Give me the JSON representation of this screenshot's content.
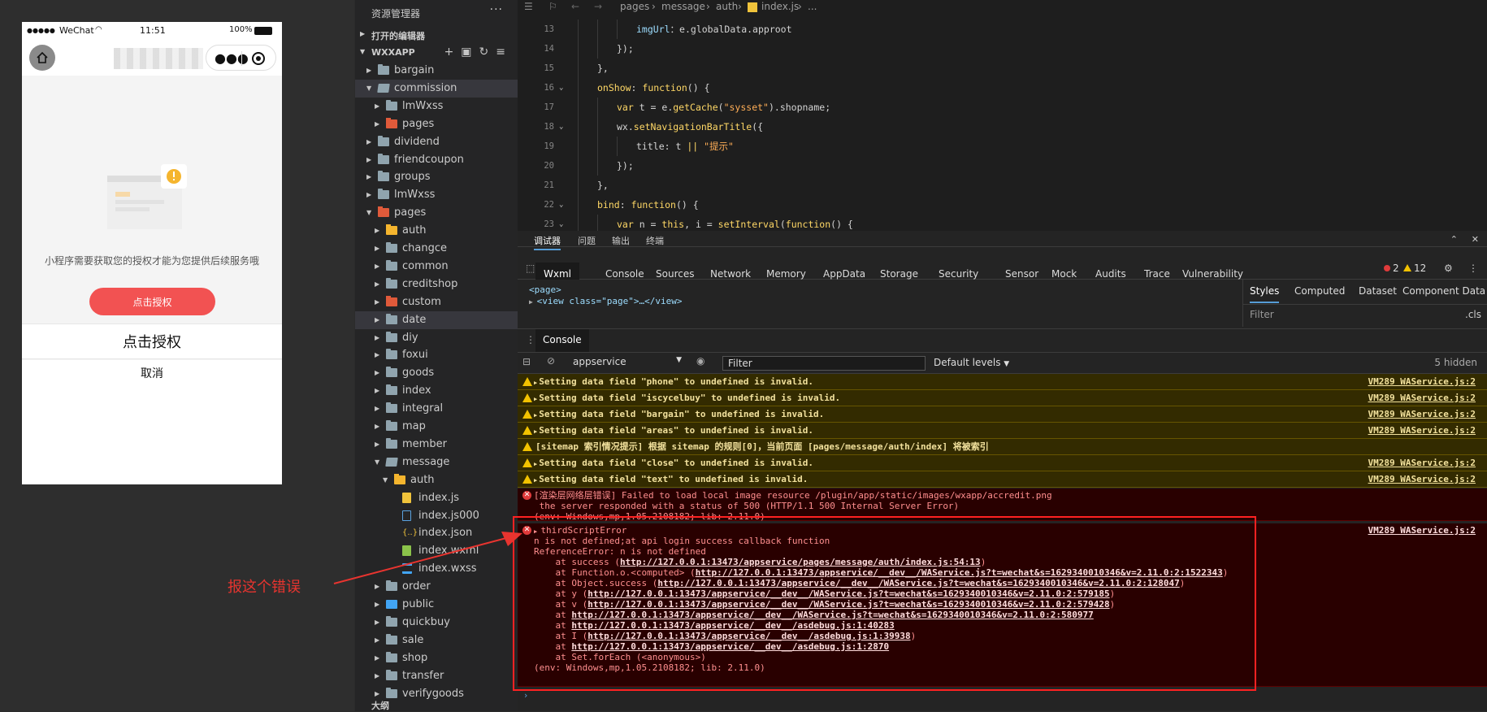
{
  "simulator": {
    "status": {
      "dots": "●●●●●",
      "carrier": "WeChat",
      "time": "11:51",
      "battery": "100%"
    },
    "auth_message": "小程序需要获取您的授权才能为您提供后续服务哦",
    "auth_button": "点击授权",
    "sheet_primary": "点击授权",
    "sheet_cancel": "取消"
  },
  "annotation": "报这个错误",
  "explorer": {
    "title": "资源管理器",
    "more": "···",
    "open_editors": "打开的编辑器",
    "project": "WXXAPP",
    "bottom_section": "大纲",
    "tree": [
      {
        "name": "bargain",
        "depth": 1,
        "icon": "folder",
        "expanded": false
      },
      {
        "name": "commission",
        "depth": 1,
        "icon": "folder-open",
        "expanded": true,
        "selected": true
      },
      {
        "name": "lmWxss",
        "depth": 2,
        "icon": "folder",
        "expanded": false
      },
      {
        "name": "pages",
        "depth": 2,
        "icon": "red",
        "expanded": false
      },
      {
        "name": "dividend",
        "depth": 1,
        "icon": "folder",
        "expanded": false
      },
      {
        "name": "friendcoupon",
        "depth": 1,
        "icon": "folder",
        "expanded": false
      },
      {
        "name": "groups",
        "depth": 1,
        "icon": "folder",
        "expanded": false
      },
      {
        "name": "lmWxss",
        "depth": 1,
        "icon": "folder",
        "expanded": false
      },
      {
        "name": "pages",
        "depth": 1,
        "icon": "red",
        "expanded": true
      },
      {
        "name": "auth",
        "depth": 2,
        "icon": "yellow",
        "expanded": false
      },
      {
        "name": "changce",
        "depth": 2,
        "icon": "folder",
        "expanded": false
      },
      {
        "name": "common",
        "depth": 2,
        "icon": "folder",
        "expanded": false
      },
      {
        "name": "creditshop",
        "depth": 2,
        "icon": "folder",
        "expanded": false
      },
      {
        "name": "custom",
        "depth": 2,
        "icon": "red",
        "expanded": false
      },
      {
        "name": "date",
        "depth": 2,
        "icon": "folder",
        "expanded": false,
        "selected": true
      },
      {
        "name": "diy",
        "depth": 2,
        "icon": "folder",
        "expanded": false
      },
      {
        "name": "foxui",
        "depth": 2,
        "icon": "folder",
        "expanded": false
      },
      {
        "name": "goods",
        "depth": 2,
        "icon": "folder",
        "expanded": false
      },
      {
        "name": "index",
        "depth": 2,
        "icon": "folder",
        "expanded": false
      },
      {
        "name": "integral",
        "depth": 2,
        "icon": "folder",
        "expanded": false
      },
      {
        "name": "map",
        "depth": 2,
        "icon": "folder",
        "expanded": false
      },
      {
        "name": "member",
        "depth": 2,
        "icon": "folder",
        "expanded": false
      },
      {
        "name": "message",
        "depth": 2,
        "icon": "folder-open",
        "expanded": true
      },
      {
        "name": "auth",
        "depth": 3,
        "icon": "yellow",
        "expanded": true
      },
      {
        "name": "index.js",
        "depth": 4,
        "icon": "file-js",
        "file": true
      },
      {
        "name": "index.js000",
        "depth": 4,
        "icon": "file-txt",
        "file": true
      },
      {
        "name": "index.json",
        "depth": 4,
        "icon": "file-json",
        "file": true
      },
      {
        "name": "index.wxml",
        "depth": 4,
        "icon": "file-wxml",
        "file": true
      },
      {
        "name": "index.wxss",
        "depth": 4,
        "icon": "file-wxss",
        "file": true
      },
      {
        "name": "order",
        "depth": 2,
        "icon": "folder",
        "expanded": false
      },
      {
        "name": "public",
        "depth": 2,
        "icon": "blue",
        "expanded": false
      },
      {
        "name": "quickbuy",
        "depth": 2,
        "icon": "folder",
        "expanded": false
      },
      {
        "name": "sale",
        "depth": 2,
        "icon": "folder",
        "expanded": false
      },
      {
        "name": "shop",
        "depth": 2,
        "icon": "folder",
        "expanded": false
      },
      {
        "name": "transfer",
        "depth": 2,
        "icon": "folder",
        "expanded": false
      },
      {
        "name": "verifygoods",
        "depth": 2,
        "icon": "folder",
        "expanded": false
      }
    ]
  },
  "editor": {
    "breadcrumb": [
      "pages",
      "message",
      "auth",
      "index.js",
      "..."
    ],
    "lines": [
      {
        "n": "13",
        "indent": 3,
        "code": [
          [
            "k-m",
            "imgUrl"
          ],
          [
            "",
            "：e.globalData.approot"
          ]
        ]
      },
      {
        "n": "14",
        "indent": 2,
        "code": [
          [
            "",
            "});"
          ]
        ]
      },
      {
        "n": "15",
        "indent": 1,
        "code": [
          [
            "",
            "},"
          ]
        ]
      },
      {
        "n": "16",
        "indent": 1,
        "fold": true,
        "code": [
          [
            "k-prop",
            "onShow"
          ],
          [
            "",
            ": "
          ],
          [
            "k-kw",
            "function"
          ],
          [
            "",
            "() {"
          ]
        ]
      },
      {
        "n": "17",
        "indent": 2,
        "code": [
          [
            "k-kw",
            "var"
          ],
          [
            "",
            " t = e."
          ],
          [
            "k-fn",
            "getCache"
          ],
          [
            "",
            "("
          ],
          [
            "k-str",
            "\"sysset\""
          ],
          [
            "",
            ").shopname;"
          ]
        ]
      },
      {
        "n": "18",
        "indent": 2,
        "fold": true,
        "code": [
          [
            "",
            "wx."
          ],
          [
            "k-fn",
            "setNavigationBarTitle"
          ],
          [
            "",
            "({"
          ]
        ]
      },
      {
        "n": "19",
        "indent": 3,
        "code": [
          [
            "",
            "title: t "
          ],
          [
            "k-kw",
            "||"
          ],
          [
            "",
            " "
          ],
          [
            "k-str",
            "\"提示\""
          ]
        ]
      },
      {
        "n": "20",
        "indent": 2,
        "code": [
          [
            "",
            "});"
          ]
        ]
      },
      {
        "n": "21",
        "indent": 1,
        "code": [
          [
            "",
            "},"
          ]
        ]
      },
      {
        "n": "22",
        "indent": 1,
        "fold": true,
        "code": [
          [
            "k-prop",
            "bind"
          ],
          [
            "",
            ": "
          ],
          [
            "k-kw",
            "function"
          ],
          [
            "",
            "() {"
          ]
        ]
      },
      {
        "n": "23",
        "indent": 2,
        "fold": true,
        "code": [
          [
            "k-kw",
            "var"
          ],
          [
            "",
            " n = "
          ],
          [
            "k-kw",
            "this"
          ],
          [
            "",
            ", i = "
          ],
          [
            "k-fn",
            "setInterval"
          ],
          [
            "",
            "("
          ],
          [
            "k-kw",
            "function"
          ],
          [
            "",
            "() {"
          ]
        ]
      }
    ]
  },
  "devtools": {
    "top_tabs": [
      "调试器",
      "问题",
      "输出",
      "终端"
    ],
    "panels": [
      "Wxml",
      "Console",
      "Sources",
      "Network",
      "Memory",
      "AppData",
      "Storage",
      "Security",
      "Sensor",
      "Mock",
      "Audits",
      "Trace",
      "Vulnerability"
    ],
    "counts": {
      "errors": "2",
      "warnings": "12"
    },
    "dom": [
      "<page>",
      "<view class=\"page\">…</view>"
    ],
    "style_tabs": [
      "Styles",
      "Computed",
      "Dataset",
      "Component Data"
    ],
    "styles_filter": "Filter",
    "styles_cls": ".cls",
    "console_tab": "Console",
    "context": "appservice",
    "filter_placeholder": "Filter",
    "levels": "Default levels",
    "hidden": "5 hidden"
  },
  "console": {
    "warnings": [
      {
        "text": "Setting data field \"phone\" to undefined is invalid.",
        "src": "VM289 WAService.js:2"
      },
      {
        "text": "Setting data field \"iscycelbuy\" to undefined is invalid.",
        "src": "VM289 WAService.js:2"
      },
      {
        "text": "Setting data field \"bargain\" to undefined is invalid.",
        "src": "VM289 WAService.js:2"
      },
      {
        "text": "Setting data field \"areas\" to undefined is invalid.",
        "src": "VM289 WAService.js:2"
      },
      {
        "text": "[sitemap 索引情况提示] 根据 sitemap 的规则[0]，当前页面 [pages/message/auth/index] 将被索引",
        "src": ""
      },
      {
        "text": "Setting data field \"close\" to undefined is invalid.",
        "src": "VM289 WAService.js:2"
      },
      {
        "text": "Setting data field \"text\" to undefined is invalid.",
        "src": "VM289 WAService.js:2"
      }
    ],
    "error1": [
      "[渲染层网络层错误] Failed to load local image resource /plugin/app/static/images/wxapp/accredit.png",
      " the server responded with a status of 500 (HTTP/1.1 500 Internal Server Error)",
      "(env: Windows,mp,1.05.2108182; lib: 2.11.0)"
    ],
    "error2_head": "thirdScriptError",
    "error2_src": "VM289 WAService.js:2",
    "error2": [
      "n is not defined;at api login success callback function",
      "ReferenceError: n is not defined"
    ],
    "trace": [
      [
        "    at success (",
        "http://127.0.0.1:13473/appservice/pages/message/auth/index.js:54:13",
        ")"
      ],
      [
        "    at Function.o.<computed> (",
        "http://127.0.0.1:13473/appservice/__dev__/WAService.js?t=wechat&s=1629340010346&v=2.11.0:2:1522343",
        ")"
      ],
      [
        "    at Object.success (",
        "http://127.0.0.1:13473/appservice/__dev__/WAService.js?t=wechat&s=1629340010346&v=2.11.0:2:128047",
        ")"
      ],
      [
        "    at y (",
        "http://127.0.0.1:13473/appservice/__dev__/WAService.js?t=wechat&s=1629340010346&v=2.11.0:2:579185",
        ")"
      ],
      [
        "    at v (",
        "http://127.0.0.1:13473/appservice/__dev__/WAService.js?t=wechat&s=1629340010346&v=2.11.0:2:579428",
        ")"
      ],
      [
        "    at ",
        "http://127.0.0.1:13473/appservice/__dev__/WAService.js?t=wechat&s=1629340010346&v=2.11.0:2:580977",
        ""
      ],
      [
        "    at ",
        "http://127.0.0.1:13473/appservice/__dev__/asdebug.js:1:40283",
        ""
      ],
      [
        "    at I (",
        "http://127.0.0.1:13473/appservice/__dev__/asdebug.js:1:39938",
        ")"
      ],
      [
        "    at ",
        "http://127.0.0.1:13473/appservice/__dev__/asdebug.js:1:2870",
        ""
      ],
      [
        "    at Set.forEach (<anonymous>)",
        "",
        ""
      ]
    ],
    "error2_env": "(env: Windows,mp,1.05.2108182; lib: 2.11.0)"
  },
  "colors": {
    "accent_red": "#f25252",
    "annotation_red": "#e8342f"
  }
}
